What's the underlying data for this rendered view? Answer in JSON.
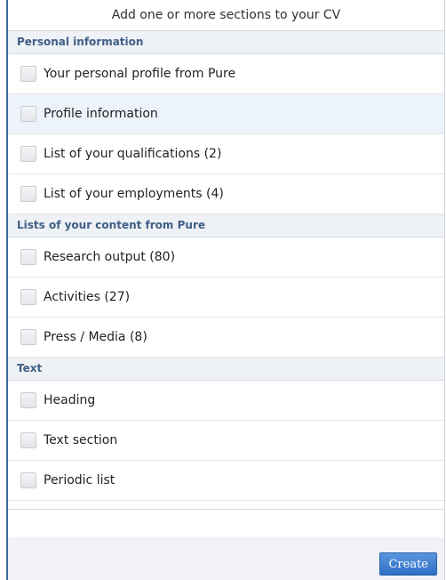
{
  "dialog": {
    "title": "Add one or more sections to your CV",
    "sections": [
      {
        "header": "Personal information",
        "items": [
          {
            "label": "Your personal profile from Pure",
            "checked": false
          },
          {
            "label": "Profile information",
            "checked": false
          },
          {
            "label": "List of your qualifications (2)",
            "checked": false
          },
          {
            "label": "List of your employments (4)",
            "checked": false
          }
        ]
      },
      {
        "header": "Lists of your content from Pure",
        "items": [
          {
            "label": "Research output (80)",
            "checked": false
          },
          {
            "label": "Activities (27)",
            "checked": false
          },
          {
            "label": "Press / Media (8)",
            "checked": false
          }
        ]
      },
      {
        "header": "Text",
        "items": [
          {
            "label": "Heading",
            "checked": false
          },
          {
            "label": "Text section",
            "checked": false
          },
          {
            "label": "Periodic list",
            "checked": false
          }
        ]
      }
    ],
    "create_label": "Create"
  },
  "colors": {
    "accent": "#2f6fc4",
    "section_header_text": "#3f5f84",
    "section_header_bg": "#eef1f5",
    "highlight_row_bg": "#edf3fb"
  }
}
